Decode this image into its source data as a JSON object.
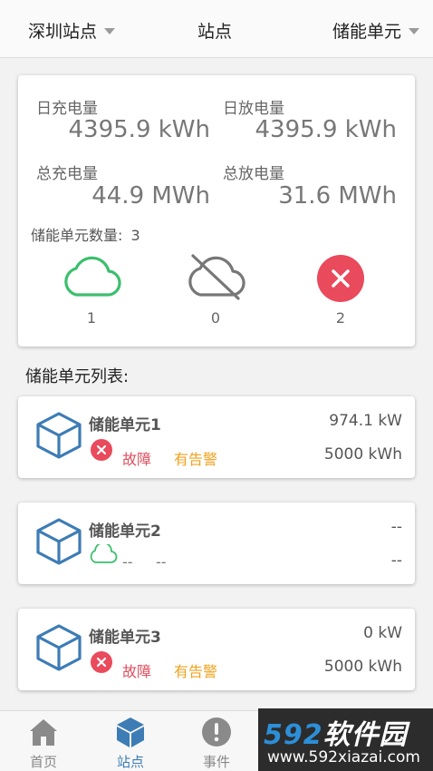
{
  "header": {
    "site_select": "深圳站点",
    "title": "站点",
    "unit_select": "储能单元"
  },
  "summary": {
    "daily_charge_label": "日充电量",
    "daily_charge_value": "4395.9 kWh",
    "daily_discharge_label": "日放电量",
    "daily_discharge_value": "4395.9 kWh",
    "total_charge_label": "总充电量",
    "total_charge_value": "44.9 MWh",
    "total_discharge_label": "总放电量",
    "total_discharge_value": "31.6 MWh",
    "unit_count_label": "储能单元数量:",
    "unit_count_value": "3",
    "online_count": "1",
    "offline_count": "0",
    "fault_count": "2"
  },
  "list_title": "储能单元列表:",
  "units": [
    {
      "name": "储能单元1",
      "power": "974.1 kW",
      "energy": "5000 kWh",
      "fault": "故障",
      "alarm": "有告警"
    },
    {
      "name": "储能单元2",
      "power": "--",
      "energy": "--",
      "status1": "--",
      "status2": "--"
    },
    {
      "name": "储能单元3",
      "power": "0 kW",
      "energy": "5000 kWh",
      "fault": "故障",
      "alarm": "有告警"
    }
  ],
  "nav": {
    "home": "首页",
    "site": "站点",
    "events": "事件"
  },
  "watermark": {
    "logo_num": "592",
    "logo_cn": "软件园",
    "url": "www.592xiazai.com"
  },
  "colors": {
    "online": "#3cbf6e",
    "offline": "#777777",
    "fault": "#e0505f",
    "alarm": "#f0a21e",
    "accent": "#3d7cb5"
  },
  "icons": {
    "online": "cloud-icon",
    "offline": "cloud-off-icon",
    "fault": "close-circle-icon",
    "unit": "cube-icon"
  }
}
